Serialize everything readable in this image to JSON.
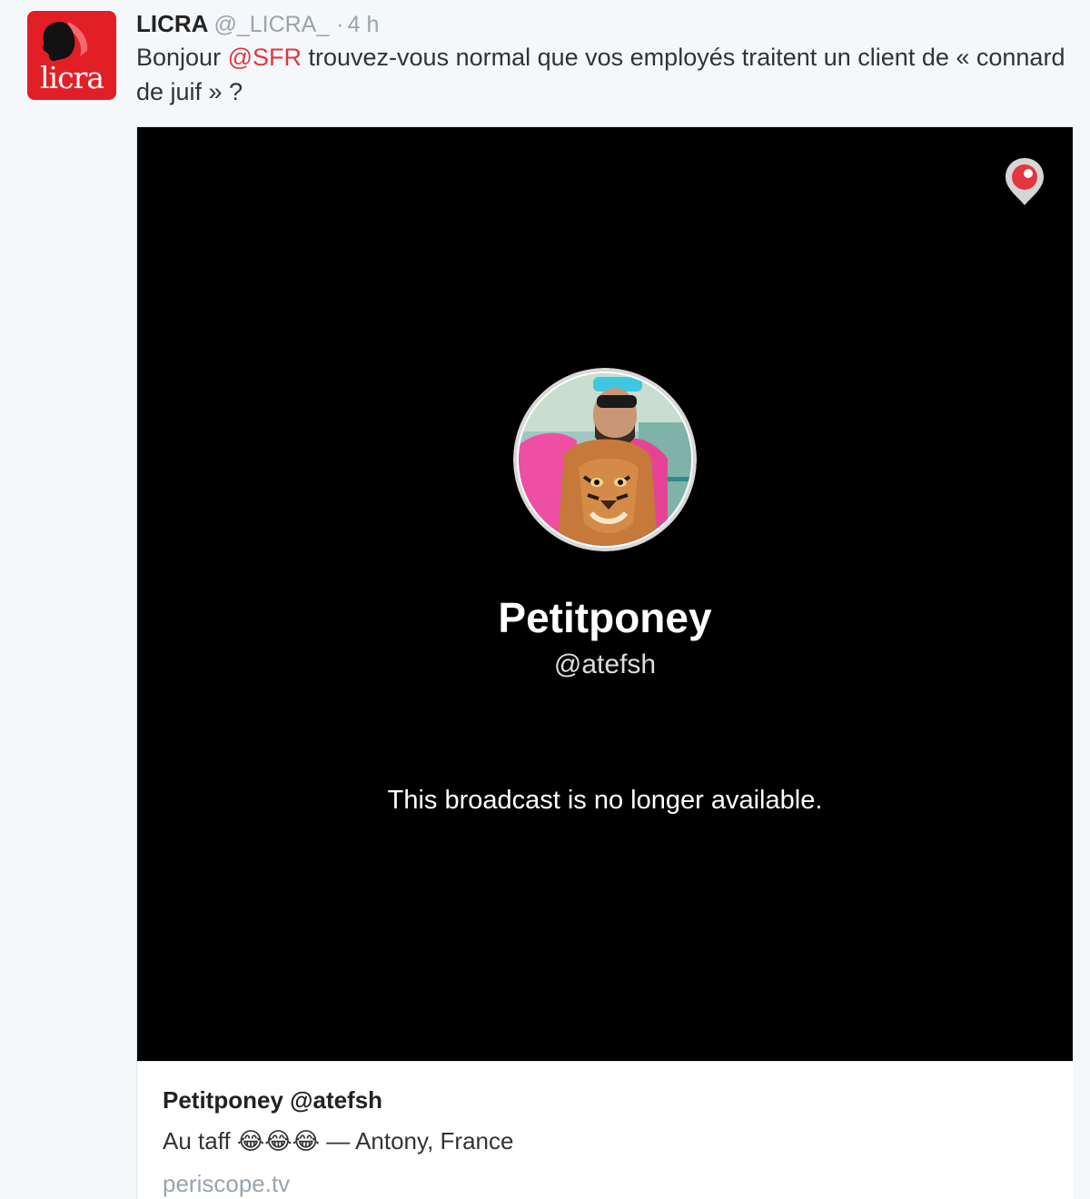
{
  "tweet": {
    "display_name": "LICRA",
    "screen_name": "@_LICRA_",
    "separator": "·",
    "timestamp": "4 h",
    "avatar_text": "licra",
    "text_before": "Bonjour ",
    "mention": "@SFR",
    "text_after": " trouvez-vous normal que vos employés traitent un client de « connard de juif » ?"
  },
  "card": {
    "logo": "periscope-pin-icon",
    "broadcaster_name": "Petitponey",
    "broadcaster_handle": "@atefsh",
    "status_message": "This broadcast is no longer available.",
    "title": "Petitponey @atefsh",
    "description": "Au taff 😂😂😂 — Antony, France",
    "domain": "periscope.tv"
  },
  "colors": {
    "brand_red": "#e21f26",
    "mention": "#e0383e",
    "player_bg": "#000000"
  }
}
